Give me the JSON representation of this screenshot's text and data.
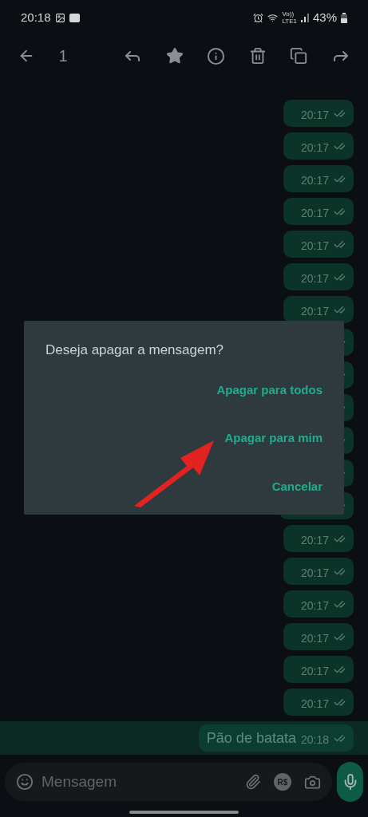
{
  "status_bar": {
    "time": "20:18",
    "network_label": [
      "Vo))",
      "LTE1"
    ],
    "battery": "43%"
  },
  "toolbar": {
    "selected_count": "1"
  },
  "messages": [
    {
      "time": "20:17",
      "selected": false
    },
    {
      "time": "20:17",
      "selected": false
    },
    {
      "time": "20:17",
      "selected": false
    },
    {
      "time": "20:17",
      "selected": false
    },
    {
      "time": "20:17",
      "selected": false
    },
    {
      "time": "20:17",
      "selected": false
    },
    {
      "time": "20:17",
      "selected": false
    },
    {
      "selected": false
    },
    {
      "selected": false
    },
    {
      "selected": false
    },
    {
      "selected": false
    },
    {
      "selected": false
    },
    {
      "selected": false
    },
    {
      "time": "20:17",
      "selected": false
    },
    {
      "time": "20:17",
      "selected": false
    },
    {
      "time": "20:17",
      "selected": false
    },
    {
      "time": "20:17",
      "selected": false
    },
    {
      "time": "20:17",
      "selected": false
    },
    {
      "time": "20:17",
      "selected": false
    },
    {
      "text": "Pão de batata",
      "time": "20:18",
      "selected": true
    }
  ],
  "dialog": {
    "title": "Deseja apagar a mensagem?",
    "actions": [
      "Apagar para todos",
      "Apagar para mim",
      "Cancelar"
    ]
  },
  "input_bar": {
    "placeholder": "Mensagem",
    "payment_label": "R$"
  }
}
